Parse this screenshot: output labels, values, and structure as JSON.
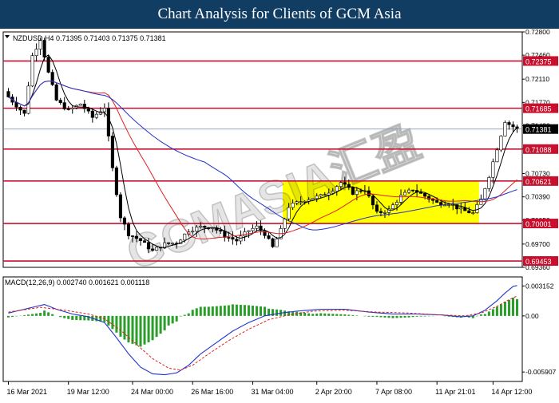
{
  "banner": {
    "title": "Chart Analysis for Clients of GCM Asia"
  },
  "watermark": "GCMASIA汇盈",
  "chart_data": [
    {
      "type": "candlestick",
      "symbol_header": "NZDUSD,H4  0.71395 0.71403 0.71375 0.71381",
      "ylim": [
        0.6936,
        0.728
      ],
      "yticks": [
        0.728,
        0.7246,
        0.7211,
        0.7177,
        0.7143,
        0.7109,
        0.7073,
        0.7039,
        0.7005,
        0.697,
        0.6936
      ],
      "ytick_labels": [
        "0.72800",
        "0.72460",
        "0.72110",
        "0.71770",
        "0.71430",
        "0.71090",
        "0.70730",
        "0.70390",
        "0.70050",
        "0.69700",
        "0.69360"
      ],
      "current_price": {
        "value": 0.71381,
        "label": "0.71381"
      },
      "levels": [
        {
          "value": 0.72375,
          "label": "0.72375"
        },
        {
          "value": 0.71685,
          "label": "0.71685"
        },
        {
          "value": 0.71088,
          "label": "0.71088"
        },
        {
          "value": 0.70621,
          "label": "0.70621"
        },
        {
          "value": 0.70001,
          "label": "0.70001"
        },
        {
          "value": 0.69453,
          "label": "0.69453"
        }
      ],
      "range_box": {
        "x_from": 69,
        "x_to": 117,
        "y_from": 0.70001,
        "y_to": 0.70621,
        "color": "#ffff00"
      },
      "num_candles": 128,
      "close_anchors": [
        [
          0,
          0.7185
        ],
        [
          4,
          0.716
        ],
        [
          6,
          0.7245
        ],
        [
          8,
          0.727
        ],
        [
          10,
          0.722
        ],
        [
          12,
          0.718
        ],
        [
          15,
          0.7165
        ],
        [
          18,
          0.7175
        ],
        [
          21,
          0.7155
        ],
        [
          24,
          0.717
        ],
        [
          26,
          0.708
        ],
        [
          28,
          0.701
        ],
        [
          30,
          0.6985
        ],
        [
          33,
          0.6975
        ],
        [
          36,
          0.696
        ],
        [
          39,
          0.697
        ],
        [
          42,
          0.6972
        ],
        [
          45,
          0.699
        ],
        [
          48,
          0.6995
        ],
        [
          51,
          0.6995
        ],
        [
          54,
          0.6982
        ],
        [
          57,
          0.6975
        ],
        [
          60,
          0.699
        ],
        [
          62,
          0.6995
        ],
        [
          64,
          0.6985
        ],
        [
          66,
          0.6965
        ],
        [
          68,
          0.699
        ],
        [
          70,
          0.7025
        ],
        [
          74,
          0.7035
        ],
        [
          78,
          0.704
        ],
        [
          81,
          0.705
        ],
        [
          83,
          0.706
        ],
        [
          86,
          0.7045
        ],
        [
          89,
          0.705
        ],
        [
          92,
          0.7015
        ],
        [
          95,
          0.702
        ],
        [
          98,
          0.704
        ],
        [
          101,
          0.705
        ],
        [
          104,
          0.704
        ],
        [
          107,
          0.703
        ],
        [
          110,
          0.703
        ],
        [
          113,
          0.702
        ],
        [
          116,
          0.7015
        ],
        [
          118,
          0.7035
        ],
        [
          120,
          0.707
        ],
        [
          122,
          0.711
        ],
        [
          124,
          0.715
        ],
        [
          125,
          0.7145
        ],
        [
          127,
          0.71381
        ]
      ],
      "series": [
        {
          "color": "#000000",
          "period": 5
        },
        {
          "color": "#dd2222",
          "period": 20
        },
        {
          "color": "#2233cc",
          "period": 50
        }
      ],
      "x_tick_labels": [
        "16 Mar 2021",
        "19 Mar 12:00",
        "24 Mar 00:00",
        "26 Mar 16:00",
        "31 Mar 04:00",
        "2 Apr 20:00",
        "7 Apr 08:00",
        "11 Apr 21:01",
        "14 Apr 12:00"
      ],
      "x_tick_index": [
        0,
        15,
        31,
        46,
        61,
        77,
        92,
        107,
        121
      ]
    },
    {
      "type": "macd",
      "title": "MACD(12,26,9) 0.002740 0.001621 0.001118",
      "ylim": [
        -0.0064,
        0.0036
      ],
      "yticks": [
        0.003152,
        0.0,
        -0.005907
      ],
      "ytick_labels": [
        "0.003152",
        "0.00",
        "-0.005907"
      ],
      "macd_line_anchors": [
        [
          0,
          0.0003
        ],
        [
          6,
          0.0009
        ],
        [
          9,
          0.0012
        ],
        [
          12,
          0.0007
        ],
        [
          16,
          0.0002
        ],
        [
          20,
          -0.0001
        ],
        [
          24,
          -0.0007
        ],
        [
          27,
          -0.0023
        ],
        [
          30,
          -0.004
        ],
        [
          33,
          -0.0054
        ],
        [
          36,
          -0.0061
        ],
        [
          39,
          -0.0062
        ],
        [
          42,
          -0.006
        ],
        [
          45,
          -0.0052
        ],
        [
          48,
          -0.004
        ],
        [
          52,
          -0.0028
        ],
        [
          56,
          -0.0016
        ],
        [
          60,
          -0.0007
        ],
        [
          64,
          0.0
        ],
        [
          68,
          0.0003
        ],
        [
          72,
          0.0005
        ],
        [
          78,
          0.0007
        ],
        [
          84,
          0.0007
        ],
        [
          90,
          0.0004
        ],
        [
          96,
          0.0002
        ],
        [
          102,
          0.0002
        ],
        [
          108,
          0.0001
        ],
        [
          113,
          -0.0001
        ],
        [
          116,
          0.0
        ],
        [
          119,
          0.0006
        ],
        [
          122,
          0.0016
        ],
        [
          124,
          0.0024
        ],
        [
          126,
          0.0031
        ],
        [
          127,
          0.0032
        ]
      ],
      "signal_line_anchors": [
        [
          0,
          0.0004
        ],
        [
          8,
          0.0009
        ],
        [
          14,
          0.0006
        ],
        [
          20,
          0.0002
        ],
        [
          24,
          -0.0003
        ],
        [
          28,
          -0.0015
        ],
        [
          32,
          -0.003
        ],
        [
          36,
          -0.0045
        ],
        [
          40,
          -0.0055
        ],
        [
          43,
          -0.0057
        ],
        [
          46,
          -0.0052
        ],
        [
          50,
          -0.004
        ],
        [
          55,
          -0.0026
        ],
        [
          60,
          -0.0014
        ],
        [
          65,
          -0.0004
        ],
        [
          70,
          0.0001
        ],
        [
          76,
          0.0005
        ],
        [
          84,
          0.0006
        ],
        [
          92,
          0.0004
        ],
        [
          100,
          0.0003
        ],
        [
          108,
          0.0001
        ],
        [
          114,
          0.0
        ],
        [
          118,
          0.0003
        ],
        [
          122,
          0.001
        ],
        [
          125,
          0.0017
        ],
        [
          127,
          0.0021
        ]
      ],
      "macd_color": "#2233cc",
      "signal_color": "#dd2222",
      "hist_color": "#2a9d2a"
    }
  ]
}
